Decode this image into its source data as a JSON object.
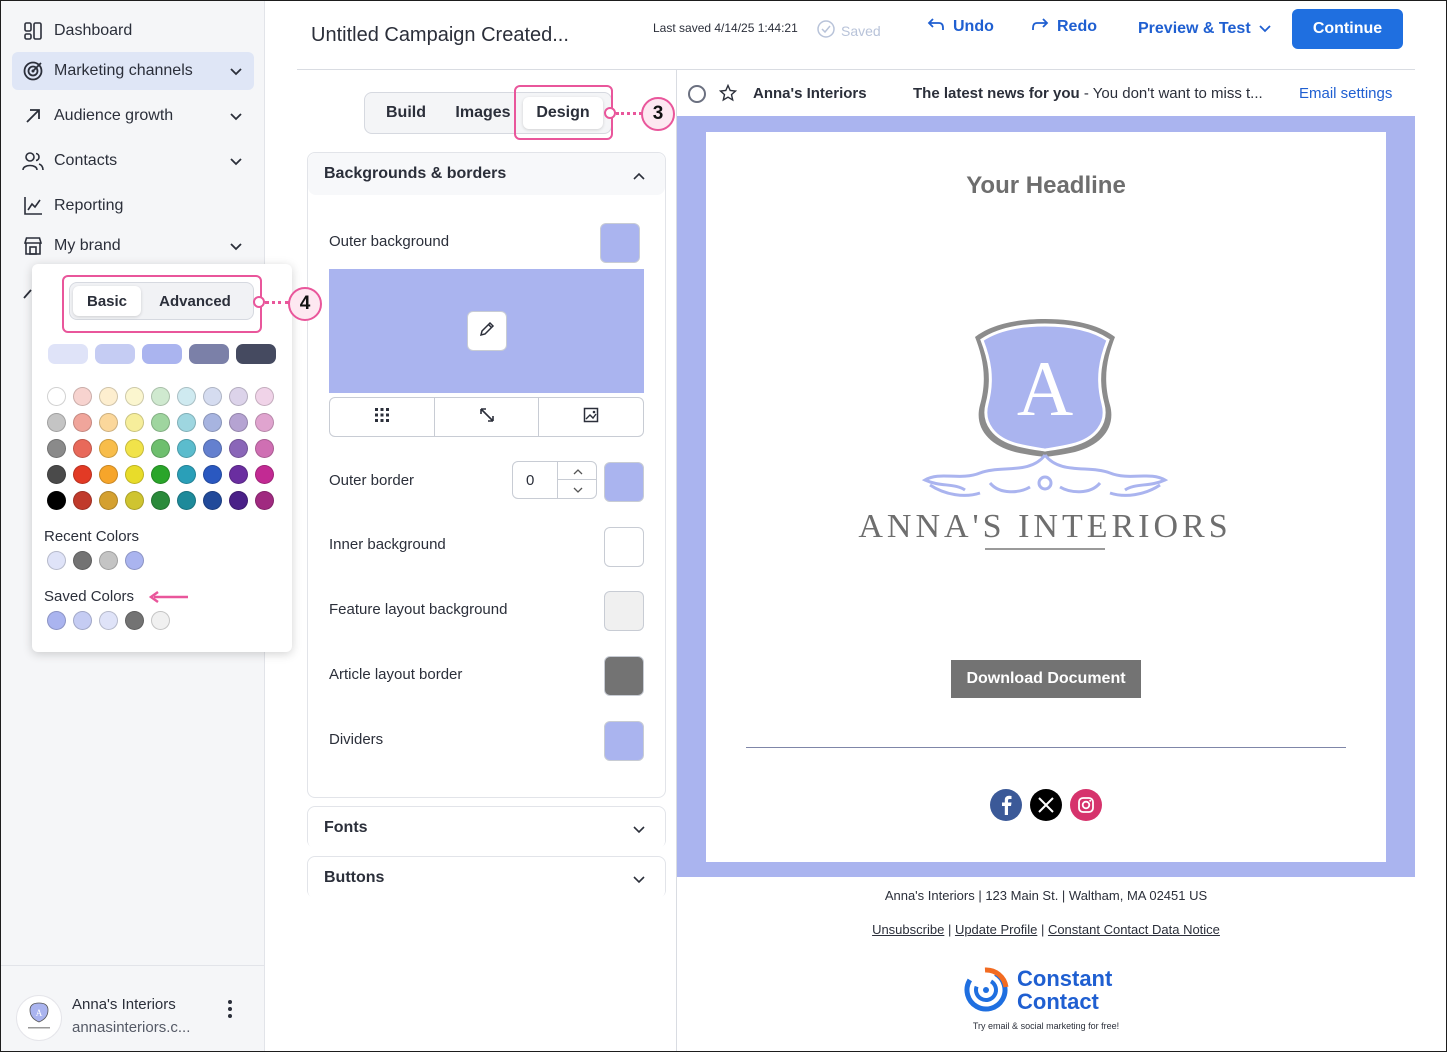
{
  "sidebar": {
    "items": [
      {
        "label": "Dashboard",
        "icon": "dashboard-icon",
        "active": false,
        "expandable": false
      },
      {
        "label": "Marketing channels",
        "icon": "target-icon",
        "active": true,
        "expandable": true
      },
      {
        "label": "Audience growth",
        "icon": "arrow-up-right-icon",
        "active": false,
        "expandable": true
      },
      {
        "label": "Contacts",
        "icon": "people-icon",
        "active": false,
        "expandable": true
      },
      {
        "label": "Reporting",
        "icon": "chart-icon",
        "active": false,
        "expandable": false
      },
      {
        "label": "My brand",
        "icon": "storefront-icon",
        "active": false,
        "expandable": true
      }
    ],
    "account": {
      "name": "Anna's Interiors",
      "site": "annasinteriors.c..."
    }
  },
  "color_picker": {
    "tabs": [
      "Basic",
      "Advanced"
    ],
    "selected_tab": "Basic",
    "brand_swatches": [
      "#dfe3f8",
      "#c5ccf3",
      "#aab4ef",
      "#7b80a8",
      "#454a60"
    ],
    "grid": [
      [
        "#ffffff",
        "#f7d3cf",
        "#fdeecf",
        "#fbf6cf",
        "#cfe9cf",
        "#cfeaf0",
        "#d5dcf0",
        "#dcd3ea",
        "#f0d3e8"
      ],
      [
        "#c4c4c4",
        "#f0a59b",
        "#fbd79b",
        "#f6ee9b",
        "#9fd59f",
        "#9ed6e0",
        "#a7b4e0",
        "#b5a3d2",
        "#e0a4cf"
      ],
      [
        "#8a8a8a",
        "#e8695a",
        "#f8bd4a",
        "#f1e34a",
        "#6ebf6e",
        "#5bbccd",
        "#6480cf",
        "#8a66b8",
        "#cf6fb3"
      ],
      [
        "#4a4a4a",
        "#e23a25",
        "#f6a52a",
        "#e8dc2a",
        "#2aa52a",
        "#2a9fb8",
        "#2a58c0",
        "#6a2ea0",
        "#c22a93"
      ],
      [
        "#000000",
        "#c03a2b",
        "#d4a030",
        "#cfc430",
        "#2a8a3a",
        "#1e8a9a",
        "#214a9a",
        "#4a2088",
        "#a02a80"
      ]
    ],
    "recent_label": "Recent Colors",
    "recent": [
      "#dfe3f8",
      "#737373",
      "#c4c4c4",
      "#aab4ef"
    ],
    "saved_label": "Saved Colors",
    "saved": [
      "#aab4ef",
      "#c5ccf3",
      "#dfe3f8",
      "#737373",
      "#f0f0f0"
    ]
  },
  "callouts": {
    "step3": "3",
    "step4": "4"
  },
  "topbar": {
    "title": "Untitled Campaign Created...",
    "last_saved": "Last saved 4/14/25 1:44:21",
    "saved": "Saved",
    "undo": "Undo",
    "redo": "Redo",
    "preview": "Preview & Test",
    "continue": "Continue"
  },
  "editor_tabs": [
    "Build",
    "Images",
    "Design"
  ],
  "editor_selected_tab": "Design",
  "backgrounds_panel": {
    "title": "Backgrounds & borders",
    "outer_background": {
      "label": "Outer background",
      "color": "#aab4ef"
    },
    "outer_border": {
      "label": "Outer border",
      "value": "0",
      "color": "#aab4ef"
    },
    "inner_background": {
      "label": "Inner background",
      "color": "#ffffff"
    },
    "feature_layout_background": {
      "label": "Feature layout background",
      "color": "#f0f0f0"
    },
    "article_layout_border": {
      "label": "Article layout border",
      "color": "#737373"
    },
    "dividers": {
      "label": "Dividers",
      "color": "#aab4ef"
    }
  },
  "fonts_panel": {
    "title": "Fonts"
  },
  "buttons_panel": {
    "title": "Buttons"
  },
  "email_preview": {
    "sender": "Anna's Interiors",
    "subject_bold": "The latest news for you",
    "subject_rest": " - You don't want to miss t...",
    "email_settings": "Email settings",
    "headline": "Your Headline",
    "logo_letter": "A",
    "logo_text": "ANNA'S INTERIORS",
    "button": "Download Document",
    "footer_address": "Anna's Interiors | 123 Main St. | Waltham, MA 02451 US",
    "footer_links": [
      "Unsubscribe",
      "Update Profile",
      "Constant Contact Data Notice"
    ],
    "cc_logo_line1": "Constant",
    "cc_logo_line2": "Contact",
    "cc_tagline": "Try email & social marketing for free!"
  }
}
